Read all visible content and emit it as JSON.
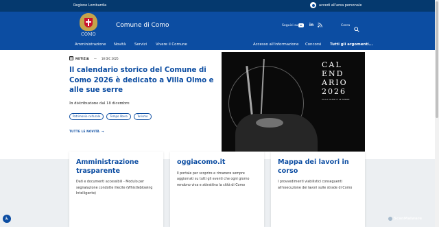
{
  "slim_header": {
    "region": "Regione Lombardia",
    "login_label": "accedi all'area personale"
  },
  "header": {
    "logo_text": "COMO",
    "site_name": "Comune di Como",
    "social_label": "Seguici su",
    "social": [
      {
        "name": "youtube-icon"
      },
      {
        "name": "linkedin-icon",
        "text": "in"
      },
      {
        "name": "rss-icon",
        "text": "Ʌ"
      }
    ],
    "search_label": "Cerca"
  },
  "nav": {
    "left": [
      "Amministrazione",
      "Novità",
      "Servizi",
      "Vivere il Comune"
    ],
    "right": [
      "Accesso all'informazione",
      "Concorsi",
      "Tutti gli argomenti..."
    ]
  },
  "hero": {
    "category": "NOTIZIA",
    "dash": "—",
    "date": "18 DIC 2025",
    "title": "Il calendario storico del Comune di Como 2026 è dedicato a Villa Olmo e alle sue serre",
    "subtitle": "In distribuzione dal 18 dicembre",
    "tags": [
      "Patrimonio culturale",
      "Tempo libero",
      "Turismo"
    ],
    "all_news": "TUTTE LE NOVITÀ",
    "arrow": "→",
    "image_title": "CALENDARIO 2026",
    "image_lines": [
      "CAL",
      "END",
      "ARIO",
      "2026"
    ],
    "image_caption": "VILLA OLMO E LE SERRE"
  },
  "cards": [
    {
      "title": "Amministrazione trasparente",
      "text": "Dati e documenti accessibili - Modulo per segnalazione condotte illecite (Whistleblowing Intelligente)"
    },
    {
      "title": "oggiacomo.it",
      "text": "Il portale per scoprire e rimanere sempre aggiornati su tutti gli eventi che ogni giorno rendono viva e attrattiva la città di Como"
    },
    {
      "title": "Mappa dei lavori in corso",
      "text": "I provvedimenti viabilistici conseguenti all'esecuzione dei lavori sulle strade di Como"
    }
  ],
  "watermark": "ScanMalware",
  "colors": {
    "primary": "#0c4da2",
    "slim": "#05396e",
    "lower_bg": "#eceff2"
  }
}
